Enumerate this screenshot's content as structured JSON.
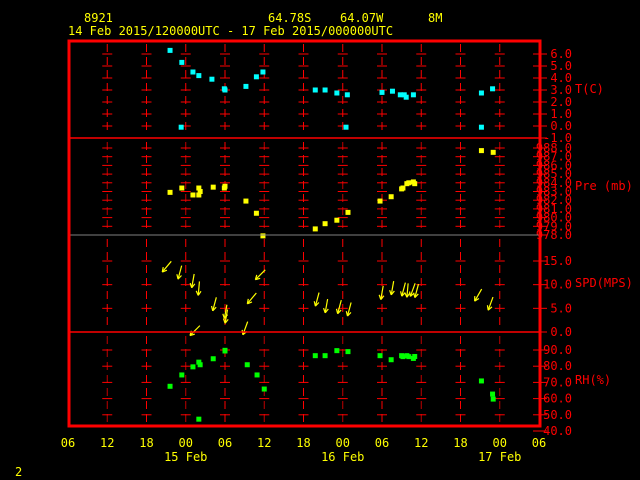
{
  "header": {
    "station": "8921",
    "lat": "64.78S",
    "lon": "64.07W",
    "elev": "8M",
    "period": "14 Feb 2015/120000UTC - 17 Feb 2015/000000UTC"
  },
  "page_number": "2",
  "colors": {
    "frame": "#ff0000",
    "text": "#ffff00",
    "temp": "#00ffff",
    "pres": "#ffff00",
    "wind": "#ffff00",
    "rh": "#00ff00",
    "gray": "#808080"
  },
  "chart_data": {
    "type": "scatter",
    "x_unit": "hours relative to 15 Feb 00 UTC",
    "xlim": [
      -18,
      54
    ],
    "x_ticks": [
      "06",
      "12",
      "18",
      "00",
      "06",
      "12",
      "18",
      "00",
      "06",
      "12",
      "18",
      "00",
      "06"
    ],
    "date_labels": [
      {
        "label": "15 Feb",
        "hour": 0
      },
      {
        "label": "16 Feb",
        "hour": 24
      },
      {
        "label": "17 Feb",
        "hour": 48
      }
    ],
    "panels": [
      {
        "name": "T(C)",
        "ylim": [
          -1,
          7
        ],
        "ticks": [
          "6.0",
          "5.0",
          "4.0",
          "3.0",
          "2.0",
          "1.0",
          "0.0",
          "-1.0"
        ],
        "tick_values": [
          6,
          5,
          4,
          3,
          2,
          1,
          0,
          -1
        ],
        "color_key": "temp",
        "marker": "square",
        "points": [
          [
            -2.4,
            6.3
          ],
          [
            -0.6,
            5.3
          ],
          [
            1.1,
            4.5
          ],
          [
            2.0,
            4.2
          ],
          [
            4.0,
            3.9
          ],
          [
            5.9,
            3.1
          ],
          [
            6.0,
            3.0
          ],
          [
            9.2,
            3.3
          ],
          [
            10.8,
            4.1
          ],
          [
            11.8,
            4.5
          ],
          [
            -0.7,
            -0.1
          ],
          [
            19.8,
            3.0
          ],
          [
            21.3,
            3.0
          ],
          [
            23.1,
            2.75
          ],
          [
            24.7,
            2.6
          ],
          [
            24.5,
            -0.1
          ],
          [
            30.0,
            2.8
          ],
          [
            31.6,
            2.9
          ],
          [
            32.8,
            2.6
          ],
          [
            33.4,
            2.6
          ],
          [
            33.7,
            2.4
          ],
          [
            34.8,
            2.6
          ],
          [
            45.2,
            2.75
          ],
          [
            46.9,
            3.1
          ],
          [
            45.2,
            -0.1
          ]
        ]
      },
      {
        "name": "Pre (mb)",
        "ylim": [
          978,
          989
        ],
        "ticks": [
          "988.0",
          "987.0",
          "986.0",
          "985.0",
          "984.0",
          "983.0",
          "982.0",
          "981.0",
          "980.0",
          "979.0",
          "978.0"
        ],
        "tick_values": [
          988,
          987,
          986,
          985,
          984,
          983,
          982,
          981,
          980,
          979,
          978
        ],
        "color_key": "pres",
        "marker": "square",
        "points": [
          [
            -2.4,
            982.9
          ],
          [
            -0.6,
            983.4
          ],
          [
            1.1,
            982.6
          ],
          [
            2.0,
            983.4
          ],
          [
            2.2,
            983.0
          ],
          [
            2.0,
            982.6
          ],
          [
            4.2,
            983.5
          ],
          [
            6.0,
            983.6
          ],
          [
            5.9,
            983.4
          ],
          [
            9.2,
            981.9
          ],
          [
            10.8,
            980.5
          ],
          [
            11.8,
            977.9
          ],
          [
            19.8,
            978.7
          ],
          [
            21.3,
            979.3
          ],
          [
            23.1,
            979.7
          ],
          [
            24.8,
            980.6
          ],
          [
            29.7,
            981.9
          ],
          [
            31.4,
            982.4
          ],
          [
            33.0,
            983.3
          ],
          [
            33.2,
            983.4
          ],
          [
            33.8,
            983.9
          ],
          [
            34.1,
            984.0
          ],
          [
            34.8,
            984.1
          ],
          [
            35.0,
            983.9
          ],
          [
            45.2,
            987.7
          ],
          [
            47.0,
            987.5
          ]
        ]
      },
      {
        "name": "SPD(MPS)",
        "ylim": [
          0,
          20.5
        ],
        "ticks": [
          "15.0",
          "10.0",
          "5.0",
          "0.0"
        ],
        "tick_values": [
          15,
          10,
          5,
          0
        ],
        "color_key": "wind",
        "marker": "arrow",
        "points": [
          [
            -2.9,
            13.8,
            40
          ],
          [
            -0.9,
            12.6,
            15
          ],
          [
            1.1,
            10.8,
            10
          ],
          [
            2.0,
            9.2,
            5
          ],
          [
            4.4,
            5.9,
            15
          ],
          [
            6.1,
            4.3,
            10
          ],
          [
            6.2,
            3.3,
            10
          ],
          [
            9.1,
            0.8,
            20
          ],
          [
            10.1,
            7.1,
            40
          ],
          [
            11.4,
            12.1,
            45
          ],
          [
            1.4,
            0.3,
            45
          ],
          [
            20.1,
            6.9,
            15
          ],
          [
            21.5,
            5.5,
            10
          ],
          [
            23.5,
            5.3,
            15
          ],
          [
            25.0,
            4.8,
            15
          ],
          [
            30.0,
            8.3,
            10
          ],
          [
            31.6,
            9.3,
            10
          ],
          [
            33.3,
            9.0,
            15
          ],
          [
            33.9,
            8.8,
            5
          ],
          [
            34.7,
            8.9,
            20
          ],
          [
            35.3,
            8.7,
            15
          ],
          [
            44.7,
            7.8,
            30
          ],
          [
            46.6,
            6.0,
            20
          ]
        ]
      },
      {
        "name": "RH(%)",
        "ylim": [
          40,
          95
        ],
        "ticks": [
          "90.0",
          "80.0",
          "70.0",
          "60.0",
          "50.0",
          "40.0"
        ],
        "tick_values": [
          90,
          80,
          70,
          60,
          50,
          40
        ],
        "color_key": "rh",
        "marker": "square",
        "points": [
          [
            -2.4,
            67.6
          ],
          [
            -0.6,
            74.6
          ],
          [
            1.1,
            79.6
          ],
          [
            2.0,
            82.5
          ],
          [
            2.2,
            80.9
          ],
          [
            2.0,
            47.3
          ],
          [
            4.2,
            84.6
          ],
          [
            6.0,
            89.4
          ],
          [
            6.0,
            89.8
          ],
          [
            9.4,
            80.9
          ],
          [
            10.9,
            74.6
          ],
          [
            12.0,
            65.9
          ],
          [
            19.8,
            86.5
          ],
          [
            21.3,
            86.5
          ],
          [
            23.1,
            89.6
          ],
          [
            24.8,
            89.0
          ],
          [
            29.7,
            86.5
          ],
          [
            31.4,
            84.0
          ],
          [
            33.0,
            86.5
          ],
          [
            33.2,
            85.9
          ],
          [
            33.8,
            86.5
          ],
          [
            34.1,
            85.9
          ],
          [
            34.8,
            84.8
          ],
          [
            35.0,
            86.0
          ],
          [
            45.2,
            70.9
          ],
          [
            46.9,
            62.8
          ],
          [
            47.0,
            59.7
          ]
        ]
      }
    ]
  }
}
